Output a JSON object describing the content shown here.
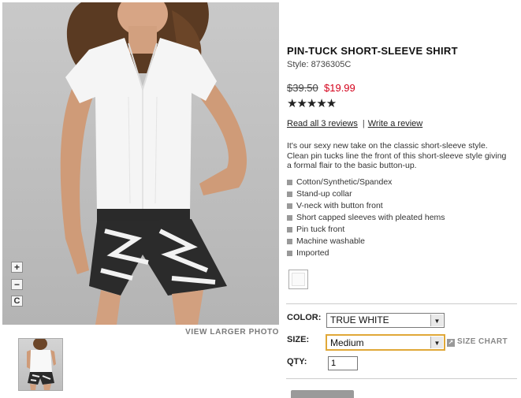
{
  "product": {
    "title": "PIN-TUCK SHORT-SLEEVE SHIRT",
    "style": "Style: 8736305C",
    "old_price": "$39.50",
    "sale_price": "$19.99",
    "rating_stars": "★★★★★",
    "rating": 5,
    "reviews_link": "Read all 3 reviews",
    "write_review_link": "Write a review",
    "description": "It's our sexy new take on the classic short-sleeve style. Clean pin tucks line the front of this short-sleeve style giving a formal flair to the basic button-up.",
    "features": [
      "Cotton/Synthetic/Spandex",
      "Stand-up collar",
      "V-neck with button front",
      "Short capped sleeves with pleated hems",
      "Pin tuck front",
      "Machine washable",
      "Imported"
    ]
  },
  "image": {
    "zoom_in": "+",
    "zoom_out": "−",
    "reset": "C",
    "view_larger": "VIEW LARGER PHOTO"
  },
  "options": {
    "color_label": "COLOR:",
    "color_value": "TRUE WHITE",
    "size_label": "SIZE:",
    "size_value": "Medium",
    "size_chart": "SIZE CHART",
    "qty_label": "QTY:",
    "qty_value": "1"
  },
  "colors": {
    "sale": "#d4001a",
    "size_focus": "#e0a838"
  }
}
